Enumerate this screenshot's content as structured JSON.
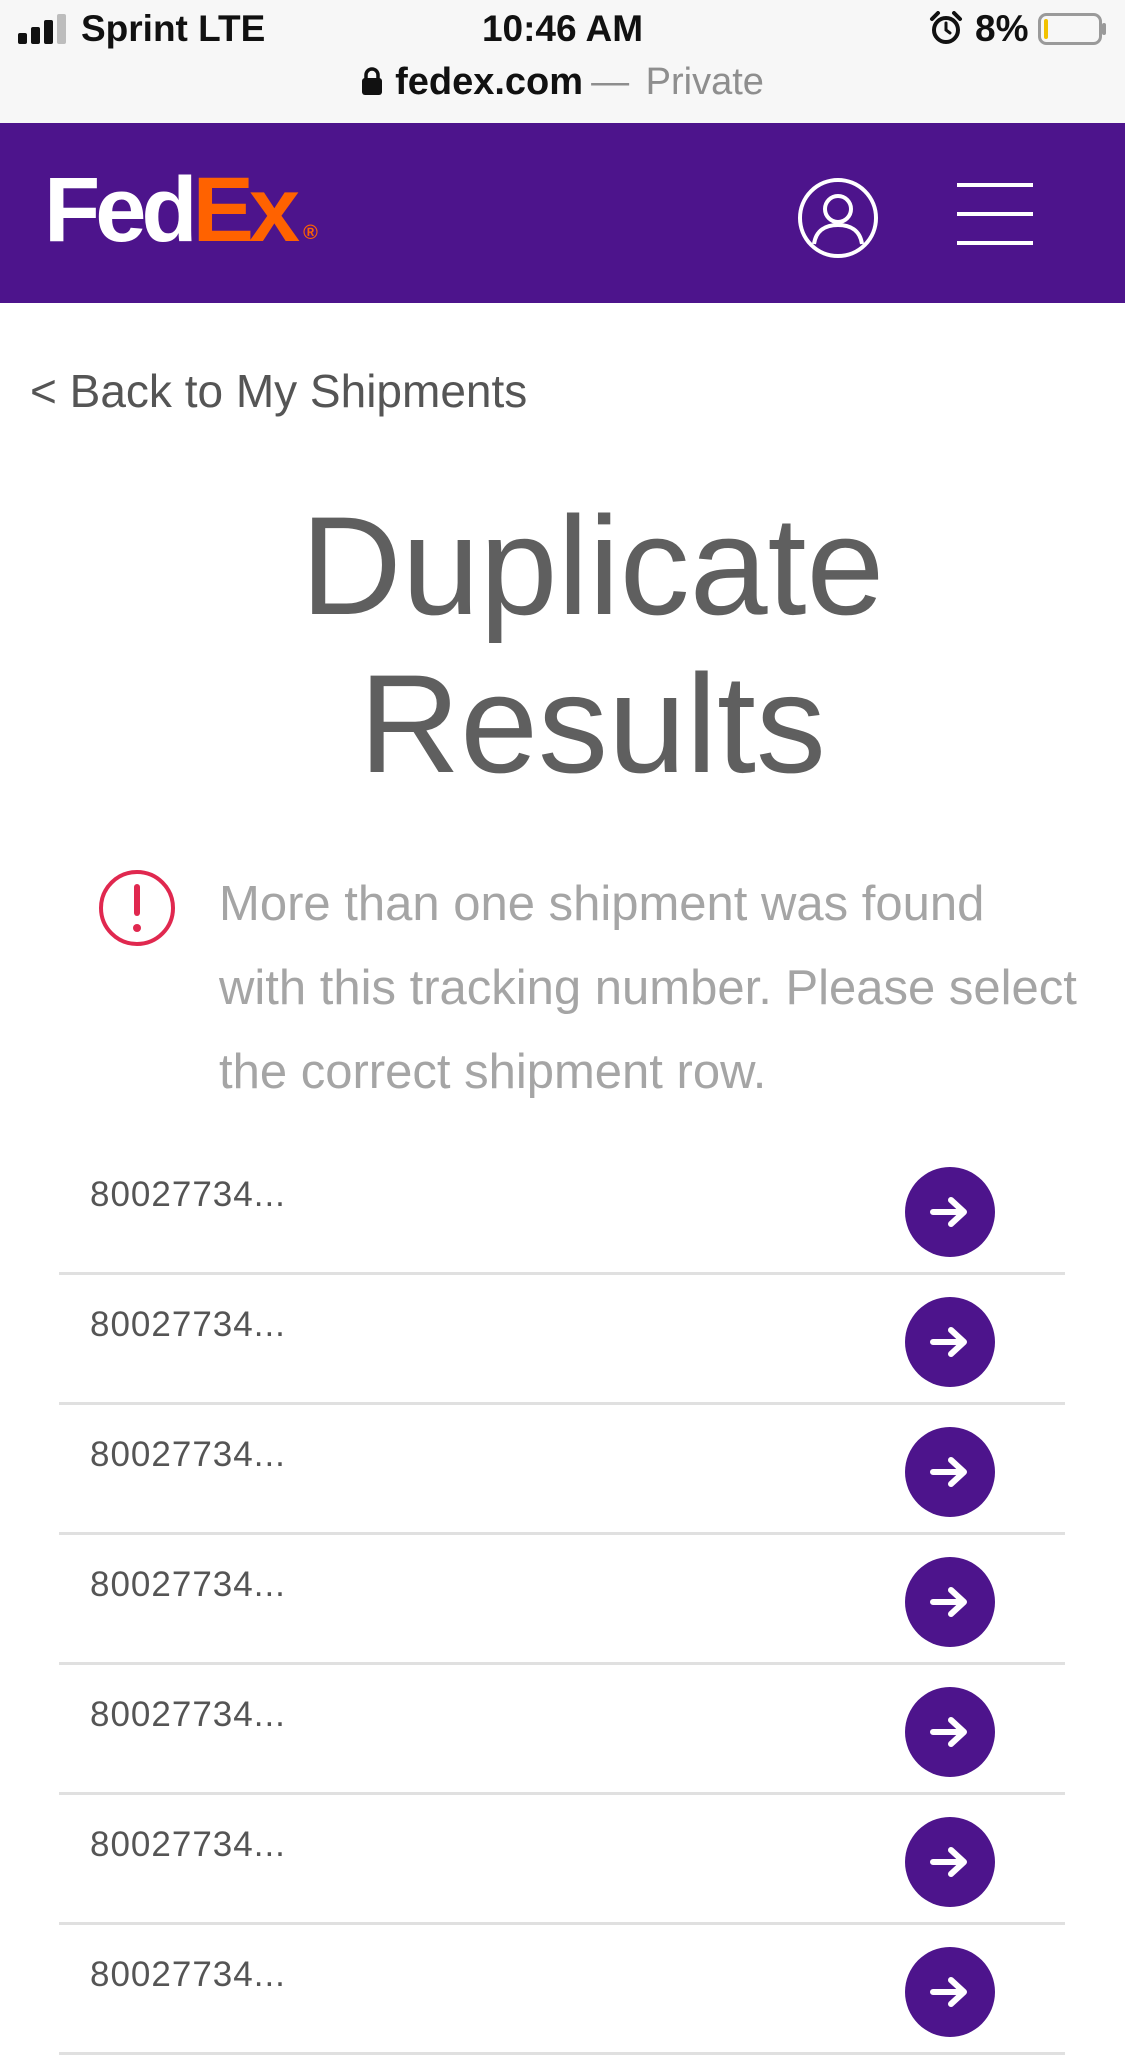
{
  "status_bar": {
    "carrier": "Sprint LTE",
    "time": "10:46 AM",
    "battery_percent": "8%",
    "battery_level": 0.08,
    "signal_bars": 3
  },
  "browser": {
    "domain": "fedex.com",
    "separator": "—",
    "mode": "Private"
  },
  "header": {
    "logo_fed": "Fed",
    "logo_ex": "Ex",
    "logo_mark": "®",
    "colors": {
      "brand_purple": "#4d148c",
      "brand_orange": "#ff6200"
    }
  },
  "back_link": "< Back to My Shipments",
  "title_line1": "Duplicate",
  "title_line2": "Results",
  "alert": {
    "icon": "alert-circle-icon",
    "color": "#e0284f",
    "message": "More than one shipment was found with this tracking number. Please select the correct shipment row."
  },
  "results": [
    {
      "tracking": "80027734..."
    },
    {
      "tracking": "80027734..."
    },
    {
      "tracking": "80027734..."
    },
    {
      "tracking": "80027734..."
    },
    {
      "tracking": "80027734..."
    },
    {
      "tracking": "80027734..."
    },
    {
      "tracking": "80027734..."
    }
  ]
}
